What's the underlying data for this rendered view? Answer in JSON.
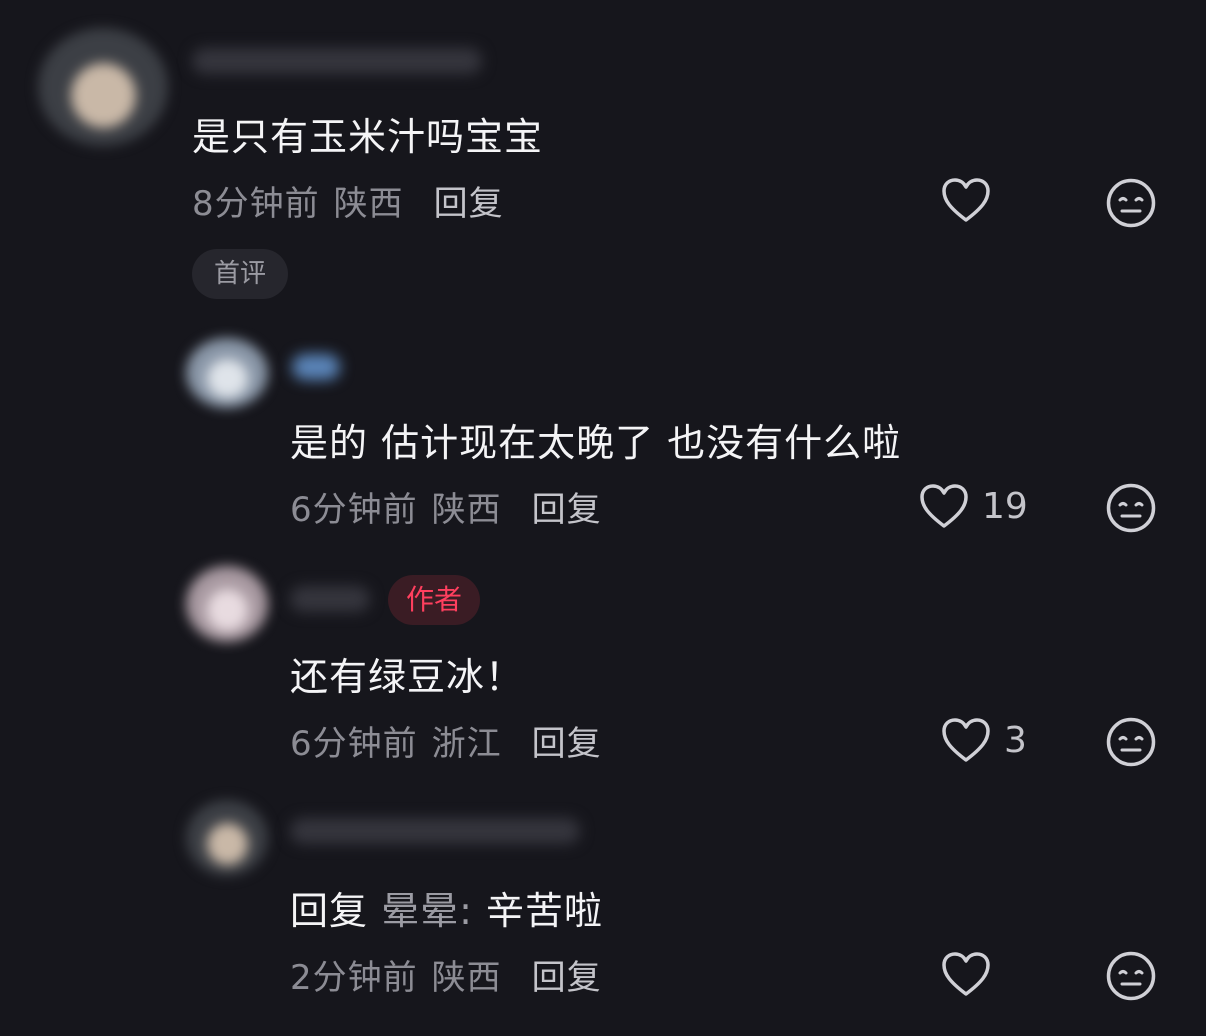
{
  "colors": {
    "background": "#16161c",
    "author_tag_text": "#ff3f5e",
    "author_tag_bg": "#3a1c24"
  },
  "comments": [
    {
      "text": "是只有玉米汁吗宝宝",
      "time": "8分钟前",
      "location": "陕西",
      "reply_label": "回复",
      "like_count": "",
      "badge": "首评"
    },
    {
      "text": "是的 估计现在太晚了 也没有什么啦",
      "time": "6分钟前",
      "location": "陕西",
      "reply_label": "回复",
      "like_count": "19"
    },
    {
      "author_badge": "作者",
      "text": "还有绿豆冰！",
      "time": "6分钟前",
      "location": "浙江",
      "reply_label": "回复",
      "like_count": "3"
    },
    {
      "reply_prefix": "回复",
      "reply_target": "晕晕:",
      "text": "辛苦啦",
      "time": "2分钟前",
      "location": "陕西",
      "reply_label": "回复",
      "like_count": ""
    }
  ],
  "icons": {
    "like": "heart-outline-icon",
    "dislike": "meh-face-icon"
  }
}
